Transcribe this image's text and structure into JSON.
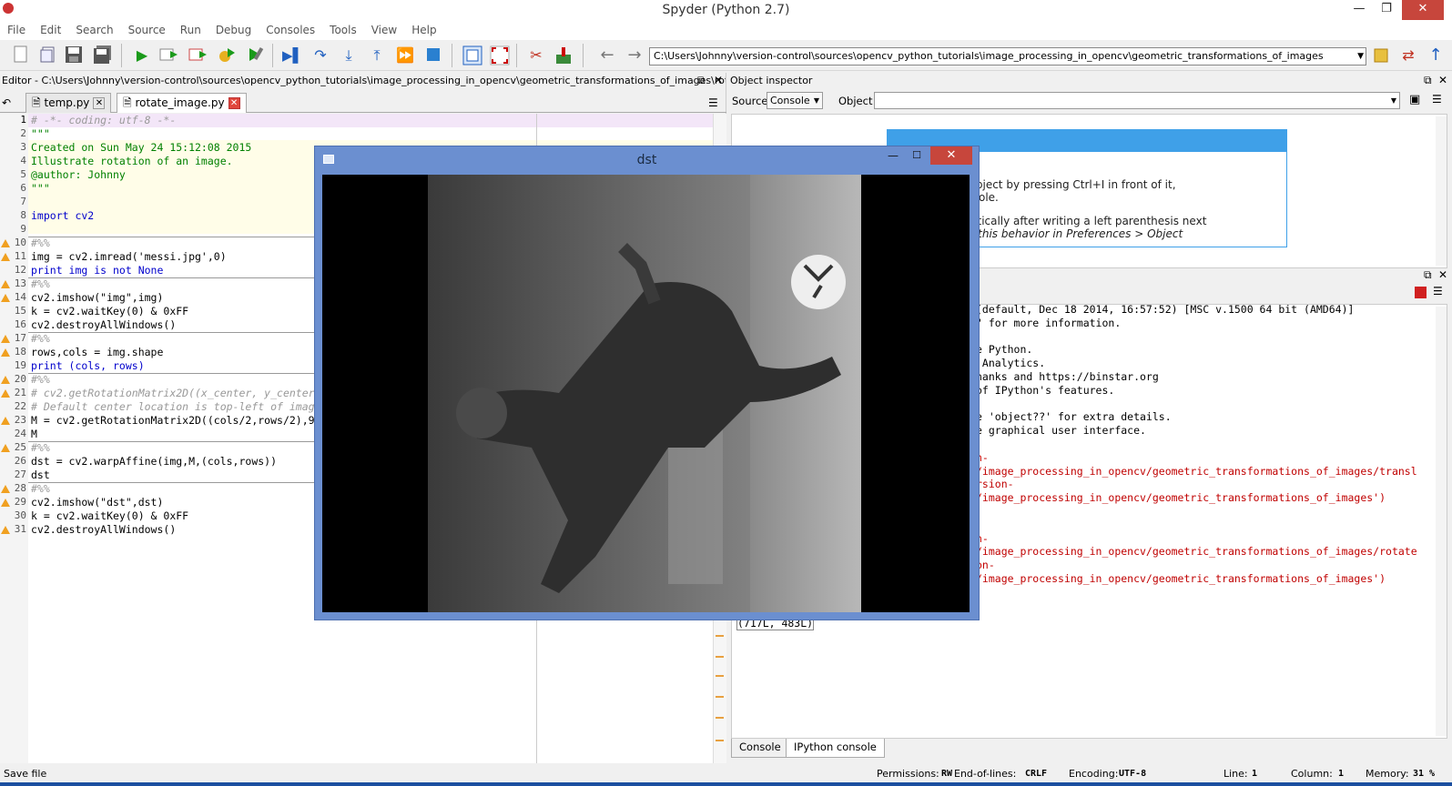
{
  "window": {
    "title": "Spyder (Python 2.7)"
  },
  "menu": [
    "File",
    "Edit",
    "Search",
    "Source",
    "Run",
    "Debug",
    "Consoles",
    "Tools",
    "View",
    "Help"
  ],
  "toolbar": {
    "path": "C:\\Users\\Johnny\\version-control\\sources\\opencv_python_tutorials\\image_processing_in_opencv\\geometric_transformations_of_images"
  },
  "editor": {
    "header": "Editor - C:\\Users\\Johnny\\version-control\\sources\\opencv_python_tutorials\\image_processing_in_opencv\\geometric_transformations_of_images\\rotate_ima...",
    "tabs": [
      {
        "label": "temp.py"
      },
      {
        "label": "rotate_image.py"
      }
    ],
    "lines": [
      {
        "n": "1",
        "text": "# -*- coding: utf-8 -*-"
      },
      {
        "n": "2",
        "text": "\"\"\""
      },
      {
        "n": "3",
        "text": "Created on Sun May 24 15:12:08 2015"
      },
      {
        "n": "4",
        "text": "Illustrate rotation of an image."
      },
      {
        "n": "5",
        "text": "@author: Johnny"
      },
      {
        "n": "6",
        "text": "\"\"\""
      },
      {
        "n": "7",
        "text": ""
      },
      {
        "n": "8",
        "text": "import cv2"
      },
      {
        "n": "9",
        "text": ""
      },
      {
        "n": "10",
        "text": "#%%"
      },
      {
        "n": "11",
        "text": "img = cv2.imread('messi.jpg',0)"
      },
      {
        "n": "12",
        "text": "print img is not None"
      },
      {
        "n": "13",
        "text": "#%%"
      },
      {
        "n": "14",
        "text": "cv2.imshow(\"img\",img)"
      },
      {
        "n": "15",
        "text": "k = cv2.waitKey(0) & 0xFF"
      },
      {
        "n": "16",
        "text": "cv2.destroyAllWindows()"
      },
      {
        "n": "17",
        "text": "#%%"
      },
      {
        "n": "18",
        "text": "rows,cols = img.shape"
      },
      {
        "n": "19",
        "text": "print (cols, rows)"
      },
      {
        "n": "20",
        "text": "#%%"
      },
      {
        "n": "21",
        "text": "# cv2.getRotationMatrix2D((x_center, y_center"
      },
      {
        "n": "22",
        "text": "# Default center location is top-left of imag"
      },
      {
        "n": "23",
        "text": "M = cv2.getRotationMatrix2D((cols/2,rows/2),9"
      },
      {
        "n": "24",
        "text": "M"
      },
      {
        "n": "25",
        "text": "#%%"
      },
      {
        "n": "26",
        "text": "dst = cv2.warpAffine(img,M,(cols,rows))"
      },
      {
        "n": "27",
        "text": "dst"
      },
      {
        "n": "28",
        "text": "#%%"
      },
      {
        "n": "29",
        "text": "cv2.imshow(\"dst\",dst)"
      },
      {
        "n": "30",
        "text": "k = cv2.waitKey(0) & 0xFF"
      },
      {
        "n": "31",
        "text": "cv2.destroyAllWindows()"
      }
    ]
  },
  "inspector": {
    "header": "Object inspector",
    "source_label": "Source",
    "source_value": "Console",
    "object_label": "Object",
    "object_value": "",
    "help_l1": "t help of any object by pressing Ctrl+I in front of it,",
    "help_l2": "tor or the Console.",
    "help_l3": "shown automatically after writing a left parenthesis next",
    "help_l4": "u can activate this behavior in Preferences > Object"
  },
  "console": {
    "lines": [
      {
        "text": "(default, Dec 18 2014, 16:57:52) [MSC v.1500 64 bit (AMD64)]",
        "red": false
      },
      {
        "text": "\" for more information.",
        "red": false
      },
      {
        "text": "",
        "red": false
      },
      {
        "text": "e Python.",
        "red": false
      },
      {
        "text": " Analytics.",
        "red": false
      },
      {
        "text": "hanks and https://binstar.org",
        "red": false
      },
      {
        "text": "of IPython's features.",
        "red": false
      },
      {
        "text": "",
        "red": false
      },
      {
        "text": "e 'object??' for extra details.",
        "red": false
      },
      {
        "text": "e graphical user interface.",
        "red": false
      },
      {
        "text": "",
        "red": false
      },
      {
        "text": "n-",
        "red": true
      },
      {
        "text": "/image_processing_in_opencv/geometric_transformations_of_images/transl",
        "red": true
      },
      {
        "text": "rsion-",
        "red": true
      },
      {
        "text": "/image_processing_in_opencv/geometric_transformations_of_images')",
        "red": true
      },
      {
        "text": "",
        "red": false
      },
      {
        "text": "",
        "red": false
      },
      {
        "text": "n-",
        "red": true
      },
      {
        "text": "/image_processing_in_opencv/geometric_transformations_of_images/rotate",
        "red": true
      },
      {
        "text": "on-",
        "red": true
      },
      {
        "text": "/image_processing_in_opencv/geometric_transformations_of_images')",
        "red": true
      }
    ],
    "output": "(717L, 483L)",
    "tabs": [
      "Console",
      "IPython console"
    ]
  },
  "dst_window": {
    "title": "dst"
  },
  "status": {
    "left": "Save file",
    "permissions_label": "Permissions:",
    "permissions": "RW",
    "eol_label": "End-of-lines:",
    "eol": "CRLF",
    "encoding_label": "Encoding:",
    "encoding": "UTF-8",
    "line_label": "Line:",
    "line": "1",
    "column_label": "Column:",
    "column": "1",
    "memory_label": "Memory:",
    "memory": "31 %"
  }
}
